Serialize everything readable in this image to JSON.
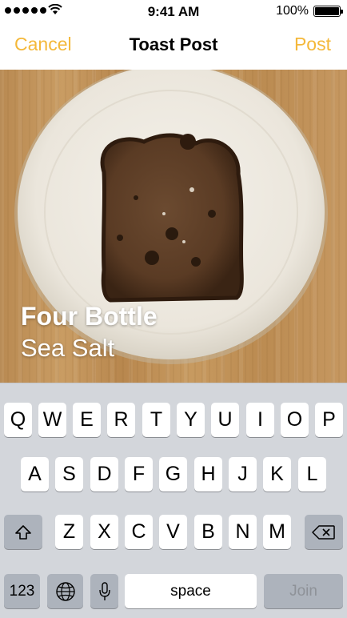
{
  "status_bar": {
    "time": "9:41 AM",
    "battery_percent": "100%",
    "signal_dots": 5,
    "battery_level": 1.0
  },
  "nav": {
    "cancel_label": "Cancel",
    "title": "Toast Post",
    "post_label": "Post",
    "accent_color": "#F4B83A"
  },
  "photo": {
    "toast_name": "Four Bottle",
    "toast_style": "Sea Salt"
  },
  "keyboard": {
    "row1": [
      "Q",
      "W",
      "E",
      "R",
      "T",
      "Y",
      "U",
      "I",
      "O",
      "P"
    ],
    "row2": [
      "A",
      "S",
      "D",
      "F",
      "G",
      "H",
      "J",
      "K",
      "L"
    ],
    "row3": [
      "Z",
      "X",
      "C",
      "V",
      "B",
      "N",
      "M"
    ],
    "numbers_label": "123",
    "space_label": "space",
    "join_label": "Join",
    "icons": {
      "shift": "shift-icon",
      "delete": "backspace-icon",
      "globe": "globe-icon",
      "mic": "microphone-icon"
    }
  }
}
